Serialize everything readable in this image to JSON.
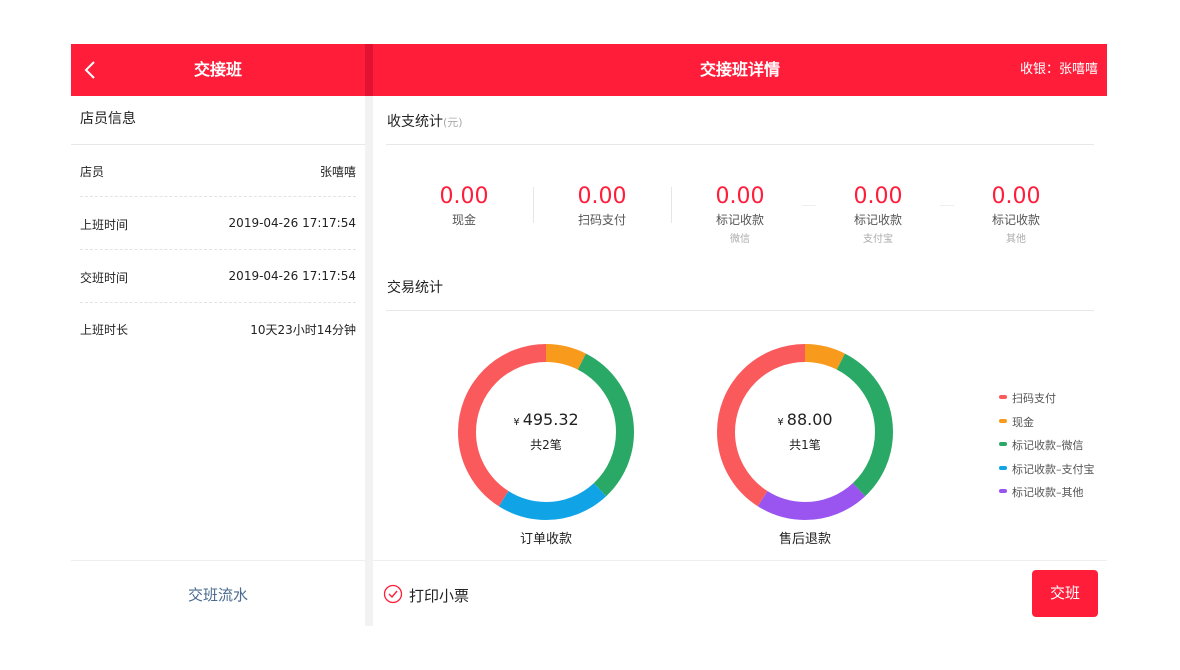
{
  "header": {
    "left_title": "交接班",
    "right_title": "交接班详情",
    "cashier": "收银：张嘻嘻"
  },
  "staff_info": {
    "section_title": "店员信息",
    "rows": [
      {
        "label": "店员",
        "value": "张嘻嘻"
      },
      {
        "label": "上班时间",
        "value": "2019-04-26 17:17:54"
      },
      {
        "label": "交班时间",
        "value": "2019-04-26 17:17:54"
      },
      {
        "label": "上班时长",
        "value": "10天23小时14分钟"
      }
    ],
    "footer_link": "交班流水"
  },
  "income_stats": {
    "title": "收支统计",
    "unit": "(元)",
    "items": [
      {
        "value": "0.00",
        "label": "现金",
        "sub": ""
      },
      {
        "value": "0.00",
        "label": "扫码支付",
        "sub": ""
      },
      {
        "value": "0.00",
        "label": "标记收款",
        "sub": "微信"
      },
      {
        "value": "0.00",
        "label": "标记收款",
        "sub": "支付宝"
      },
      {
        "value": "0.00",
        "label": "标记收款",
        "sub": "其他"
      }
    ]
  },
  "transaction_stats": {
    "title": "交易统计",
    "legend": [
      {
        "label": "扫码支付",
        "color": "#fb5a5d"
      },
      {
        "label": "现金",
        "color": "#f89a1c"
      },
      {
        "label": "标记收款–微信",
        "color": "#2aa866"
      },
      {
        "label": "标记收款–支付宝",
        "color": "#10a4e6"
      },
      {
        "label": "标记收款–其他",
        "color": "#9a55f0"
      }
    ],
    "donuts": [
      {
        "currency": "¥",
        "amount": "495.32",
        "count": "共2笔",
        "label": "订单收款",
        "segments": [
          {
            "category": "现金",
            "color": "#f89a1c",
            "share": 0.075
          },
          {
            "category": "标记收款–微信",
            "color": "#2aa866",
            "share": 0.305
          },
          {
            "category": "标记收款–支付宝",
            "color": "#10a4e6",
            "share": 0.21
          },
          {
            "category": "扫码支付",
            "color": "#fb5a5d",
            "share": 0.41
          }
        ]
      },
      {
        "currency": "¥",
        "amount": "88.00",
        "count": "共1笔",
        "label": "售后退款",
        "segments": [
          {
            "category": "现金",
            "color": "#f89a1c",
            "share": 0.075
          },
          {
            "category": "标记收款–微信",
            "color": "#2aa866",
            "share": 0.305
          },
          {
            "category": "标记收款–其他",
            "color": "#9a55f0",
            "share": 0.21
          },
          {
            "category": "扫码支付",
            "color": "#fb5a5d",
            "share": 0.41
          }
        ]
      }
    ]
  },
  "footer": {
    "print_label": "打印小票",
    "print_checked": true,
    "handover_button": "交班"
  },
  "colors": {
    "brand": "#ff1d3a",
    "link": "#4a6a8f"
  },
  "icons": {
    "back": "chevron-left-icon",
    "print_check": "check-circle-icon"
  }
}
